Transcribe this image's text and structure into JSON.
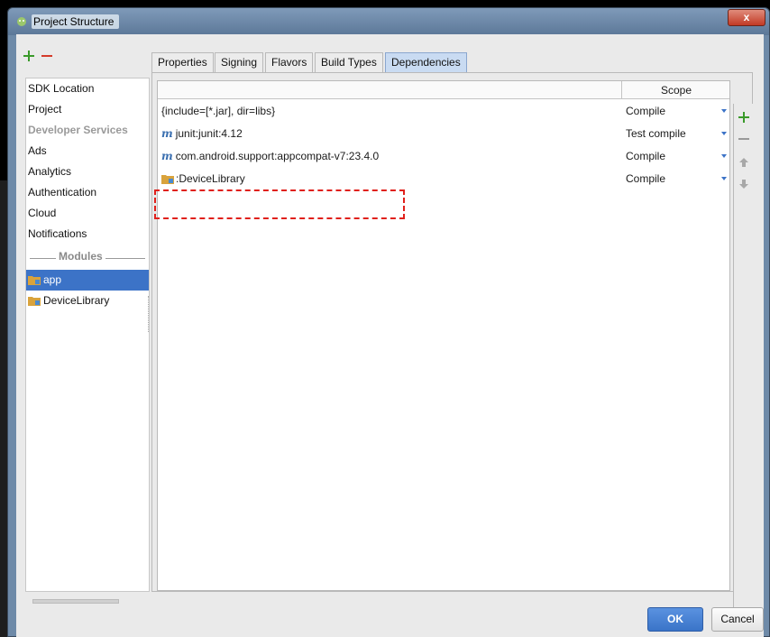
{
  "window": {
    "title": "Project Structure",
    "close_glyph": "x",
    "accent": "#3c73c7"
  },
  "left_panel": {
    "items": [
      {
        "label": "SDK Location",
        "state": "normal"
      },
      {
        "label": "Project",
        "state": "normal"
      },
      {
        "label": "Developer Services",
        "state": "disabled"
      },
      {
        "label": "Ads",
        "state": "normal"
      },
      {
        "label": "Analytics",
        "state": "normal"
      },
      {
        "label": "Authentication",
        "state": "normal"
      },
      {
        "label": "Cloud",
        "state": "normal"
      },
      {
        "label": "Notifications",
        "state": "normal"
      }
    ],
    "modules_label": "Modules",
    "modules": [
      {
        "label": "app",
        "selected": true,
        "icon": "module-folder-icon"
      },
      {
        "label": "DeviceLibrary",
        "selected": false,
        "icon": "module-folder-icon"
      }
    ]
  },
  "tabs": [
    {
      "label": "Properties",
      "active": false
    },
    {
      "label": "Signing",
      "active": false
    },
    {
      "label": "Flavors",
      "active": false
    },
    {
      "label": "Build Types",
      "active": false
    },
    {
      "label": "Dependencies",
      "active": true
    }
  ],
  "dependencies": {
    "scope_header": "Scope",
    "rows": [
      {
        "prefix": "",
        "name": "{include=[*.jar], dir=libs}",
        "scope": "Compile",
        "icon": "none"
      },
      {
        "prefix": "m",
        "name": "junit:junit:4.12",
        "scope": "Test compile",
        "icon": "maven-icon"
      },
      {
        "prefix": "m",
        "name": "com.android.support:appcompat-v7:23.4.0",
        "scope": "Compile",
        "icon": "maven-icon"
      },
      {
        "prefix": "",
        "name": ":DeviceLibrary",
        "scope": "Compile",
        "icon": "module-folder-icon",
        "highlighted": true
      }
    ]
  },
  "buttons": {
    "ok": "OK",
    "cancel": "Cancel"
  }
}
